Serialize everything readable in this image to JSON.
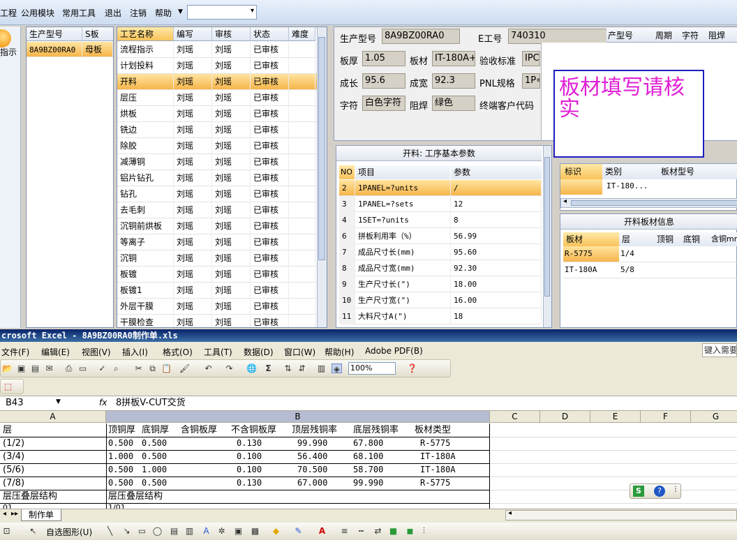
{
  "menu": {
    "items": [
      "工程",
      "公用模块",
      "常用工具",
      "退出",
      "注销",
      "帮助"
    ],
    "combo_value": ""
  },
  "left_button": {
    "label": "指示"
  },
  "model_grid": {
    "headers": [
      "生产型号",
      "S板"
    ],
    "rows": [
      [
        "8A9BZ00RA0",
        "母板"
      ]
    ]
  },
  "process_grid": {
    "headers": [
      "工艺名称",
      "编写",
      "审核",
      "状态",
      "难度"
    ],
    "rows": [
      [
        "流程指示",
        "刘瑶",
        "刘瑶",
        "已审核"
      ],
      [
        "计划投料",
        "刘瑶",
        "刘瑶",
        "已审核"
      ],
      [
        "开料",
        "刘瑶",
        "刘瑶",
        "已审核"
      ],
      [
        "层压",
        "刘瑶",
        "刘瑶",
        "已审核"
      ],
      [
        "烘板",
        "刘瑶",
        "刘瑶",
        "已审核"
      ],
      [
        "铣边",
        "刘瑶",
        "刘瑶",
        "已审核"
      ],
      [
        "除胶",
        "刘瑶",
        "刘瑶",
        "已审核"
      ],
      [
        "减薄铜",
        "刘瑶",
        "刘瑶",
        "已审核"
      ],
      [
        "铝片钻孔",
        "刘瑶",
        "刘瑶",
        "已审核"
      ],
      [
        "钻孔",
        "刘瑶",
        "刘瑶",
        "已审核"
      ],
      [
        "去毛刺",
        "刘瑶",
        "刘瑶",
        "已审核"
      ],
      [
        "沉铜前烘板",
        "刘瑶",
        "刘瑶",
        "已审核"
      ],
      [
        "等离子",
        "刘瑶",
        "刘瑶",
        "已审核"
      ],
      [
        "沉铜",
        "刘瑶",
        "刘瑶",
        "已审核"
      ],
      [
        "板镀",
        "刘瑶",
        "刘瑶",
        "已审核"
      ],
      [
        "板镀1",
        "刘瑶",
        "刘瑶",
        "已审核"
      ],
      [
        "外层干膜",
        "刘瑶",
        "刘瑶",
        "已审核"
      ],
      [
        "干膜检查",
        "刘瑶",
        "刘瑶",
        "已审核"
      ]
    ]
  },
  "info": {
    "prod_model_label": "生产型号",
    "prod_model": "8A9BZ00RA0",
    "eno_label": "E工号",
    "eno": "740310",
    "thickness_label": "板厚",
    "thickness": "1.05",
    "material_label": "板材",
    "material": "IT-180A+",
    "std_label": "验收标准",
    "std": "IPC",
    "length_label": "成长",
    "length": "95.6",
    "width_label": "成宽",
    "width": "92.3",
    "pnl_label": "PNL规格",
    "pnl": "1P=",
    "char_label": "字符",
    "char": "白色字符",
    "mask_label": "阻焊",
    "mask": "绿色",
    "customer_label": "终端客户代码"
  },
  "bubble_text": "板材填写请核实",
  "right_header": {
    "cols": [
      "产型号",
      "周期",
      "字符",
      "阻焊"
    ]
  },
  "params": {
    "title": "开料: 工序基本参数",
    "headers": [
      "NO",
      "项目",
      "参数"
    ],
    "rows": [
      [
        "2",
        "1PANEL=?units",
        "/"
      ],
      [
        "3",
        "1PANEL=?sets",
        "12"
      ],
      [
        "4",
        "1SET=?units",
        "8"
      ],
      [
        "6",
        "拼板利用率（%）",
        "56.99"
      ],
      [
        "7",
        "成品尺寸长(mm)",
        "95.60"
      ],
      [
        "8",
        "成品尺寸宽(mm)",
        "92.30"
      ],
      [
        "9",
        "生产尺寸长(\")",
        "18.00"
      ],
      [
        "10",
        "生产尺寸宽(\")",
        "16.00"
      ],
      [
        "11",
        "大料尺寸A(\")",
        "18"
      ]
    ]
  },
  "mark_grid": {
    "headers": [
      "标识",
      "类别",
      "板材型号"
    ],
    "rows": [
      [
        "",
        "IT-180...",
        ""
      ]
    ]
  },
  "material_info": {
    "title": "开料板材信息",
    "headers": [
      "板材",
      "层",
      "顶铜",
      "底铜",
      "含铜mm"
    ],
    "rows": [
      [
        "R-5775",
        "1/4"
      ],
      [
        "IT-180A",
        "5/8"
      ]
    ]
  },
  "excel": {
    "title": "crosoft Excel - 8A9BZ00RA0制作单.xls",
    "menu": [
      "文件(F)",
      "编辑(E)",
      "视图(V)",
      "插入(I)",
      "格式(O)",
      "工具(T)",
      "数据(D)",
      "窗口(W)",
      "帮助(H)",
      "Adobe PDF(B)"
    ],
    "help_hint": "键入需要",
    "zoom": "100%",
    "name_box": "B43",
    "fx": "fx",
    "formula": "8拼板V-CUT交货",
    "col_headers": [
      "A",
      "B",
      "C",
      "D",
      "E",
      "F",
      "G"
    ],
    "table_header": [
      "层",
      "顶铜厚",
      "底铜厚",
      "含铜板厚",
      "不含铜板厚",
      "顶层残铜率",
      "底层残铜率",
      "板材类型"
    ],
    "rows": [
      [
        "(1/2)",
        "0.500",
        "0.500",
        "",
        "0.130",
        "99.990",
        "67.800",
        "R-5775"
      ],
      [
        "(3/4)",
        "1.000",
        "0.500",
        "",
        "0.100",
        "56.400",
        "68.100",
        "IT-180A"
      ],
      [
        "(5/6)",
        "0.500",
        "1.000",
        "",
        "0.100",
        "70.500",
        "58.700",
        "IT-180A"
      ],
      [
        "(7/8)",
        "0.500",
        "0.500",
        "",
        "0.130",
        "67.000",
        "99.990",
        "R-5775"
      ]
    ],
    "stack_label_a": "层压叠层结构",
    "stack_label_b": "层压叠层结构",
    "partial_row_a": "01",
    "partial_row_b": "1/01",
    "sheet_tab": "制作单",
    "drawbar_label": "自选图形(U)"
  }
}
